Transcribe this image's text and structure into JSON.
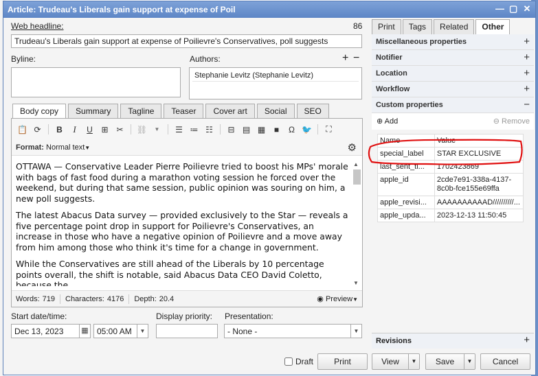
{
  "window": {
    "title": "Article: Trudeau's Liberals gain support at expense of Poil",
    "controls": [
      "—",
      "▢",
      "✕"
    ]
  },
  "headline": {
    "label": "Web headline:",
    "count": "86",
    "value": "Trudeau's Liberals gain support at expense of Poilievre's Conservatives, poll suggests"
  },
  "byline": {
    "label": "Byline:",
    "value": ""
  },
  "authors": {
    "label": "Authors:",
    "add": "+",
    "remove": "−",
    "items": [
      "Stephanie Levitz (Stephanie Levitz)"
    ]
  },
  "editor_tabs": [
    "Body copy",
    "Summary",
    "Tagline",
    "Teaser",
    "Cover art",
    "Social",
    "SEO"
  ],
  "format": {
    "label": "Format:",
    "value": "Normal text"
  },
  "body": [
    "OTTAWA — Conservative Leader Pierre Poilievre tried to boost his MPs' morale with bags of fast food during a marathon voting session he forced over the weekend, but during that same session, public opinion was souring on him, a new poll suggests.",
    "The latest Abacus Data survey — provided exclusively to the Star — reveals a five percentage point drop in support for Poilievre's Conservatives, an increase in those who have a negative opinion of Poilievre and a move away from him among those who think it's time for a change in government.",
    "While the Conservatives are still ahead of the Liberals by 10 percentage points overall, the shift is notable, said Abacus Data CEO David Coletto, because the"
  ],
  "stats": {
    "words_label": "Words:",
    "words": "719",
    "chars_label": "Characters:",
    "chars": "4176",
    "depth_label": "Depth:",
    "depth": "20.4",
    "preview": "Preview"
  },
  "schedule": {
    "date_label": "Start date/time:",
    "date": "Dec 13, 2023",
    "time": "05:00 AM",
    "priority_label": "Display priority:",
    "priority": "",
    "presentation_label": "Presentation:",
    "presentation": "- None -"
  },
  "right_tabs": [
    "Print",
    "Tags",
    "Related",
    "Other"
  ],
  "active_right_tab": "Other",
  "sections": [
    {
      "label": "Miscellaneous properties",
      "toggle": "+"
    },
    {
      "label": "Notifier",
      "toggle": "+"
    },
    {
      "label": "Location",
      "toggle": "+"
    },
    {
      "label": "Workflow",
      "toggle": "+"
    },
    {
      "label": "Custom properties",
      "toggle": "−"
    }
  ],
  "custom_properties": {
    "add": "Add",
    "remove": "Remove",
    "headers": [
      "Name",
      "Value"
    ],
    "rows": [
      [
        "special_label",
        "STAR EXCLUSIVE"
      ],
      [
        "last_sent_ti...",
        "1702423869"
      ],
      [
        "apple_id",
        "2cde7e91-338a-4137-8c0b-fce155e69ffa"
      ],
      [
        "apple_revisi...",
        "AAAAAAAAAAD//////////..."
      ],
      [
        "apple_upda...",
        "2023-12-13 11:50:45"
      ]
    ]
  },
  "revisions": {
    "label": "Revisions",
    "toggle": "+"
  },
  "footer": {
    "draft": "Draft",
    "print": "Print",
    "view": "View",
    "save": "Save",
    "cancel": "Cancel"
  },
  "colors": {
    "titlebar": "#5d86c6",
    "annotation": "#e01010"
  }
}
